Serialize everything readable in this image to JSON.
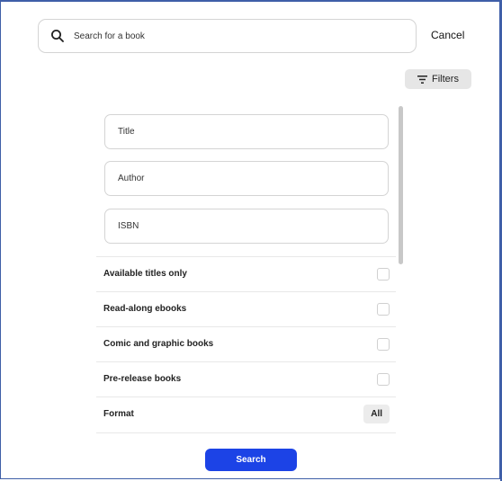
{
  "search": {
    "placeholder": "Search for a book",
    "icon": "search-icon"
  },
  "header": {
    "cancel_label": "Cancel"
  },
  "filters": {
    "label": "Filters",
    "icon": "filter-icon"
  },
  "fields": [
    {
      "placeholder": "Title"
    },
    {
      "placeholder": "Author"
    },
    {
      "placeholder": "ISBN"
    }
  ],
  "options": [
    {
      "label": "Available titles only"
    },
    {
      "label": "Read-along ebooks"
    },
    {
      "label": "Comic and graphic books"
    },
    {
      "label": "Pre-release books"
    }
  ],
  "format": {
    "label": "Format",
    "value": "All"
  },
  "submit": {
    "label": "Search"
  },
  "colors": {
    "primary": "#1c43e6",
    "frame": "#3f5fa8"
  }
}
